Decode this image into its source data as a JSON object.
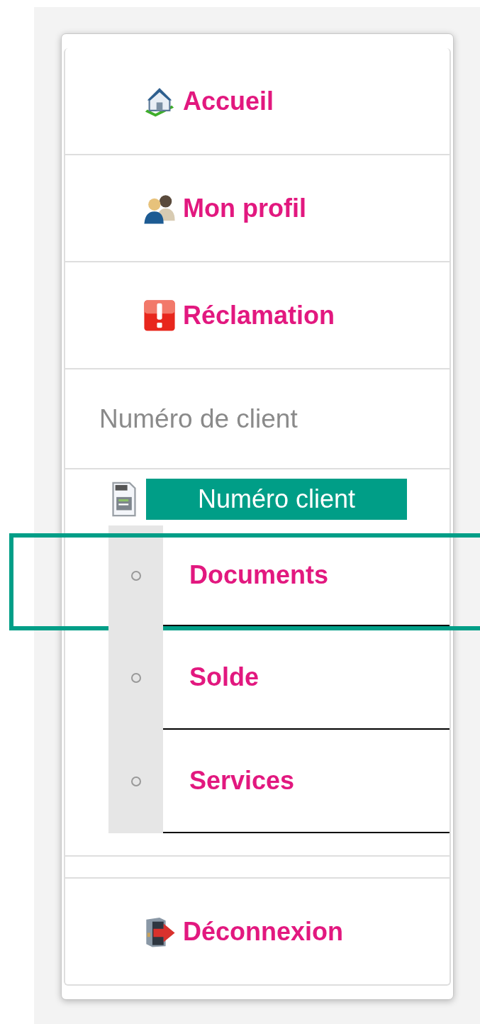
{
  "menu": [
    {
      "kind": "home",
      "label": "Accueil"
    },
    {
      "kind": "profile",
      "label": "Mon profil"
    },
    {
      "kind": "alert",
      "label": "Réclamation"
    }
  ],
  "client_section": {
    "heading": "Numéro de client",
    "button": "Numéro client",
    "items": [
      {
        "label": "Documents",
        "selected": true
      },
      {
        "label": "Solde",
        "selected": false
      },
      {
        "label": "Services",
        "selected": false
      }
    ]
  },
  "logout": {
    "kind": "exit",
    "label": "Déconnexion"
  }
}
